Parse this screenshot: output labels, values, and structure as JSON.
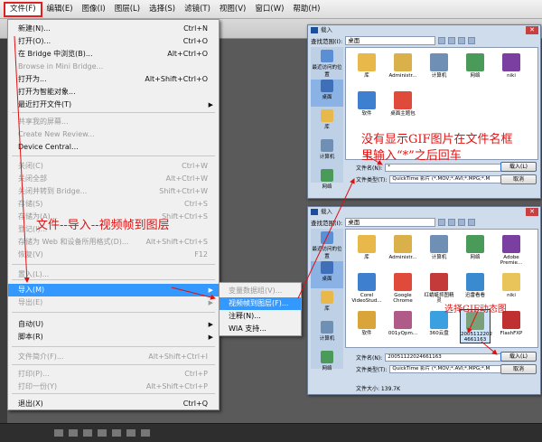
{
  "menubar": {
    "items": [
      {
        "label": "文件(F)",
        "active": true
      },
      {
        "label": "编辑(E)"
      },
      {
        "label": "图像(I)"
      },
      {
        "label": "图层(L)"
      },
      {
        "label": "选择(S)"
      },
      {
        "label": "滤镜(T)"
      },
      {
        "label": "视图(V)"
      },
      {
        "label": "窗口(W)"
      },
      {
        "label": "帮助(H)"
      }
    ]
  },
  "file_menu": {
    "items": [
      {
        "label": "新建(N)...",
        "shortcut": "Ctrl+N"
      },
      {
        "label": "打开(O)...",
        "shortcut": "Ctrl+O"
      },
      {
        "label": "在 Bridge 中浏览(B)...",
        "shortcut": "Alt+Ctrl+O"
      },
      {
        "label": "Browse in Mini Bridge...",
        "shortcut": "",
        "disabled": true
      },
      {
        "label": "打开为...",
        "shortcut": "Alt+Shift+Ctrl+O"
      },
      {
        "label": "打开为智能对象...",
        "shortcut": ""
      },
      {
        "label": "最近打开文件(T)",
        "shortcut": "",
        "submenu": true
      },
      {
        "label": "共享我的屏幕...",
        "shortcut": "",
        "disabled": true
      },
      {
        "label": "Create New Review...",
        "shortcut": "",
        "disabled": true
      },
      {
        "label": "Device Central...",
        "shortcut": ""
      },
      {
        "label": "关闭(C)",
        "shortcut": "Ctrl+W",
        "disabled": true
      },
      {
        "label": "关闭全部",
        "shortcut": "Alt+Ctrl+W",
        "disabled": true
      },
      {
        "label": "关闭并转到 Bridge...",
        "shortcut": "Shift+Ctrl+W",
        "disabled": true
      },
      {
        "label": "存储(S)",
        "shortcut": "Ctrl+S",
        "disabled": true
      },
      {
        "label": "存储为(A)...",
        "shortcut": "Shift+Ctrl+S",
        "disabled": true
      },
      {
        "label": "登记(I)...",
        "shortcut": "",
        "disabled": true
      },
      {
        "label": "存储为 Web 和设备所用格式(D)...",
        "shortcut": "Alt+Shift+Ctrl+S",
        "disabled": true
      },
      {
        "label": "恢复(V)",
        "shortcut": "F12",
        "disabled": true
      },
      {
        "label": "置入(L)...",
        "shortcut": "",
        "disabled": true
      },
      {
        "label": "导入(M)",
        "shortcut": "",
        "submenu": true,
        "highlight": true
      },
      {
        "label": "导出(E)",
        "shortcut": "",
        "submenu": true,
        "disabled": true
      },
      {
        "label": "自动(U)",
        "shortcut": "",
        "submenu": true
      },
      {
        "label": "脚本(R)",
        "shortcut": "",
        "submenu": true
      },
      {
        "label": "文件简介(F)...",
        "shortcut": "Alt+Shift+Ctrl+I",
        "disabled": true
      },
      {
        "label": "打印(P)...",
        "shortcut": "Ctrl+P",
        "disabled": true
      },
      {
        "label": "打印一份(Y)",
        "shortcut": "Alt+Shift+Ctrl+P",
        "disabled": true
      },
      {
        "label": "退出(X)",
        "shortcut": "Ctrl+Q"
      }
    ]
  },
  "import_submenu": {
    "items": [
      {
        "label": "变量数据组(V)...",
        "disabled": true
      },
      {
        "label": "视频帧到图层(F)...",
        "highlight": true
      },
      {
        "label": "注释(N)..."
      },
      {
        "label": "WIA 支持..."
      }
    ]
  },
  "dialog1": {
    "title": "载入",
    "look_in_label": "查找范围(I):",
    "look_in_value": "桌面",
    "places": [
      "最近访问的位置",
      "桌面",
      "库",
      "计算机",
      "网络"
    ],
    "files": [
      "库",
      "Administr...",
      "计算机",
      "网络",
      "niki",
      "软件",
      "桌面主题包"
    ],
    "filename_label": "文件名(N):",
    "filename_value": "*",
    "filetype_label": "文件类型(T):",
    "filetype_value": "QuickTime 影片 (*.MOV;*.AVI;*.MPG;*.M",
    "load_button": "载入(L)",
    "cancel_button": "取消"
  },
  "dialog2": {
    "title": "载入",
    "look_in_label": "查找范围(I):",
    "look_in_value": "桌面",
    "places": [
      "最近访问的位置",
      "桌面",
      "库",
      "计算机",
      "网络"
    ],
    "files": [
      "库",
      "Administr...",
      "计算机",
      "网络",
      "Adobe Premie...",
      "Corel VideoStud...",
      "Google Chrome",
      "红蜻蜓抓图精灵",
      "迅雷看看",
      "niki",
      "软件",
      "001yQpm...",
      "360云盘",
      "2005112202 4661163",
      "FlashFXP"
    ],
    "filename_label": "文件名(N):",
    "filename_value": "20051122024661163",
    "filetype_label": "文件类型(T):",
    "filetype_value": "QuickTime 影片 (*.MOV;*.AVI;*.MPG;*.M",
    "filesize_label": "文件大小: 139.7K",
    "load_button": "载入(L)",
    "cancel_button": "取消"
  },
  "annotations": {
    "path_text": "文件--导入--视频帧到图层",
    "hint_line1": "没有显示GIF图片在文件名框",
    "hint_line2": "里输入“*”之后回车",
    "select_gif": "选择GIF动态图"
  },
  "colors": {
    "annotation": "#e01010",
    "highlight": "#3399ff"
  }
}
